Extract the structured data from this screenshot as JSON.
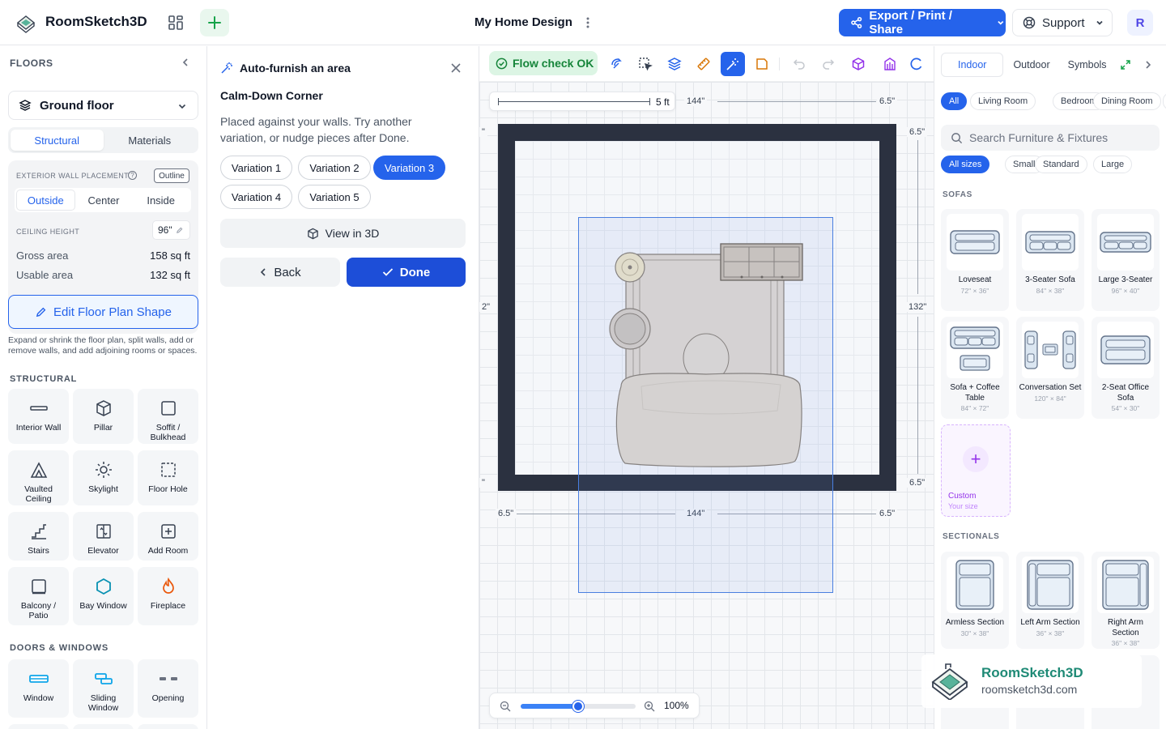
{
  "header": {
    "app_name": "RoomSketch3D",
    "doc_title": "My Home Design",
    "export_label": "Export / Print / Share",
    "support_label": "Support",
    "avatar_initial": "R"
  },
  "sidebar": {
    "title": "FLOORS",
    "floor": "Ground floor",
    "tabs": [
      "Structural",
      "Materials"
    ],
    "active_tab": "Structural",
    "wall_placement_label": "EXTERIOR WALL PLACEMENT",
    "outline_tag": "Outline",
    "help_glyph": "?",
    "placement_options": [
      "Outside",
      "Center",
      "Inside"
    ],
    "active_placement": "Outside",
    "ceiling_label": "CEILING HEIGHT",
    "ceiling_value": "96\"",
    "gross_area_label": "Gross area",
    "gross_area": "158 sq ft",
    "usable_area_label": "Usable area",
    "usable_area": "132 sq ft",
    "edit_shape_label": "Edit Floor Plan Shape",
    "edit_shape_help": "Expand or shrink the floor plan, split walls, add or remove walls, and add adjoining rooms or spaces.",
    "structural_heading": "STRUCTURAL",
    "structural_items": [
      {
        "label": "Interior Wall",
        "icon": "interior-wall-icon"
      },
      {
        "label": "Pillar",
        "icon": "pillar-icon"
      },
      {
        "label": "Soffit / Bulkhead",
        "icon": "soffit-icon"
      },
      {
        "label": "Vaulted Ceiling",
        "icon": "vaulted-ceiling-icon"
      },
      {
        "label": "Skylight",
        "icon": "skylight-icon"
      },
      {
        "label": "Floor Hole",
        "icon": "floor-hole-icon"
      },
      {
        "label": "Stairs",
        "icon": "stairs-icon"
      },
      {
        "label": "Elevator",
        "icon": "elevator-icon"
      },
      {
        "label": "Add Room",
        "icon": "add-room-icon"
      },
      {
        "label": "Balcony / Patio",
        "icon": "balcony-icon"
      },
      {
        "label": "Bay Window",
        "icon": "bay-window-icon"
      },
      {
        "label": "Fireplace",
        "icon": "fireplace-icon"
      }
    ],
    "doors_heading": "DOORS & WINDOWS",
    "door_items": [
      {
        "label": "Window",
        "icon": "window-icon"
      },
      {
        "label": "Sliding Window",
        "icon": "sliding-window-icon"
      },
      {
        "label": "Opening",
        "icon": "opening-icon"
      }
    ]
  },
  "panel": {
    "title": "Auto-furnish an area",
    "subtitle": "Calm-Down Corner",
    "description": "Placed against your walls. Try another variation, or nudge pieces after Done.",
    "variations": [
      "Variation 1",
      "Variation 2",
      "Variation 3",
      "Variation 4",
      "Variation 5"
    ],
    "active_variation": "Variation 3",
    "view3d_label": "View in 3D",
    "back_label": "Back",
    "done_label": "Done"
  },
  "canvas": {
    "flow_label": "Flow check OK",
    "scale_label": "5 ft",
    "dims": {
      "top_width": "144\"",
      "top_right_wall": "6.5\"",
      "right_top_wall": "6.5\"",
      "right_height": "132\"",
      "right_bottom_wall": "6.5\"",
      "bottom_left_wall": "6.5\"",
      "bottom_width": "144\"",
      "bottom_right_wall": "6.5\"",
      "left_marks": [
        "\"",
        "2\"",
        "\""
      ]
    },
    "zoom_level": 0.5,
    "zoom_label": "100%"
  },
  "catalog": {
    "tabs": [
      "Indoor",
      "Outdoor",
      "Symbols"
    ],
    "active_tab": "Indoor",
    "room_filters": [
      "All",
      "Living Room",
      "Bedroom",
      "Dining Room"
    ],
    "active_room_filter": "All",
    "search_placeholder": "Search Furniture & Fixtures",
    "size_filters": [
      "All sizes",
      "Small",
      "Standard",
      "Large"
    ],
    "active_size_filter": "All sizes",
    "sofas_heading": "SOFAS",
    "sofas": [
      {
        "name": "Loveseat",
        "size": "72\" × 36\""
      },
      {
        "name": "3-Seater Sofa",
        "size": "84\" × 38\""
      },
      {
        "name": "Large 3-Seater",
        "size": "96\" × 40\""
      },
      {
        "name": "Sofa + Coffee Table",
        "size": "84\" × 72\""
      },
      {
        "name": "Conversation Set",
        "size": "120\" × 84\""
      },
      {
        "name": "2-Seat Office Sofa",
        "size": "54\" × 30\""
      }
    ],
    "custom_label": "Custom",
    "custom_sub": "Your size",
    "sectionals_heading": "SECTIONALS",
    "sectionals": [
      {
        "name": "Armless Section",
        "size": "30\" × 38\""
      },
      {
        "name": "Left Arm Section",
        "size": "36\" × 38\""
      },
      {
        "name": "Right Arm Section",
        "size": "36\" × 38\""
      }
    ]
  },
  "watermark": {
    "brand": "RoomSketch3D",
    "url": "roomsketch3d.com"
  },
  "colors": {
    "accent": "#2563eb",
    "flow_ok": "#16853a",
    "wall": "#2b3140",
    "custom_accent": "#9333ea"
  }
}
